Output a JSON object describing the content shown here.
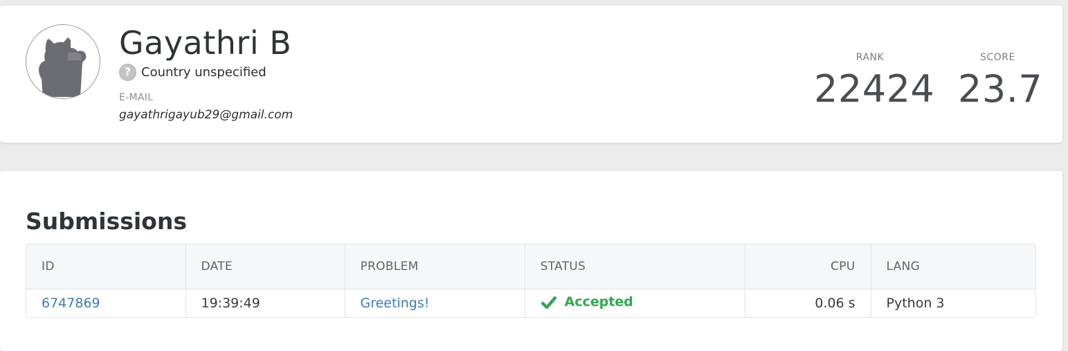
{
  "profile": {
    "name": "Gayathri B",
    "country_flag_icon": "question-mark-icon",
    "country_flag_glyph": "?",
    "country": "Country unspecified",
    "email_label": "E-MAIL",
    "email": "gayathrigayub29@gmail.com",
    "avatar_icon": "default-cat-avatar-icon"
  },
  "stats": {
    "rank_label": "RANK",
    "rank_value": "22424",
    "score_label": "SCORE",
    "score_value": "23.7"
  },
  "submissions": {
    "title": "Submissions",
    "columns": {
      "id": "ID",
      "date": "DATE",
      "problem": "PROBLEM",
      "status": "STATUS",
      "cpu": "CPU",
      "lang": "LANG"
    },
    "rows": [
      {
        "id": "6747869",
        "date": "19:39:49",
        "problem": "Greetings!",
        "status": "Accepted",
        "status_icon": "check-icon",
        "cpu": "0.06 s",
        "lang": "Python 3"
      }
    ]
  },
  "colors": {
    "accepted": "#2fa84f",
    "link": "#3f7ab8",
    "background": "#ebebeb"
  }
}
